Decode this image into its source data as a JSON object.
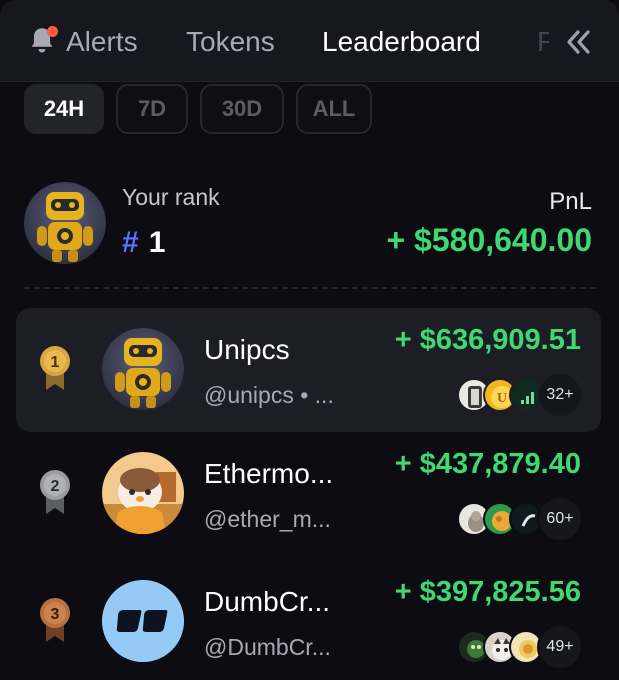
{
  "nav": {
    "tabs": [
      {
        "label": "Alerts",
        "icon": "bell-icon",
        "active": false,
        "has_notification": true
      },
      {
        "label": "Tokens",
        "active": false
      },
      {
        "label": "Leaderboard",
        "active": true
      },
      {
        "label": "F",
        "active": false
      }
    ],
    "collapse_icon": "double-chevron-left-icon"
  },
  "filters": [
    {
      "label": "24H",
      "active": true
    },
    {
      "label": "7D",
      "active": false
    },
    {
      "label": "30D",
      "active": false
    },
    {
      "label": "ALL",
      "active": false
    }
  ],
  "your_rank": {
    "label": "Your rank",
    "hash": "#",
    "rank": "1",
    "pnl_label": "PnL",
    "pnl": "+ $580,640.00"
  },
  "leaderboard": [
    {
      "rank": "1",
      "medal": "gold",
      "name": "Unipcs",
      "handle": "@unipcs • ...",
      "pnl": "+ $636,909.51",
      "tokens_more": "32+"
    },
    {
      "rank": "2",
      "medal": "silver",
      "name": "Ethermo...",
      "handle": "@ether_m...",
      "pnl": "+ $437,879.40",
      "tokens_more": "60+"
    },
    {
      "rank": "3",
      "medal": "bronze",
      "name": "DumbCr...",
      "handle": "@DumbCr...",
      "pnl": "+ $397,825.56",
      "tokens_more": "49+"
    }
  ],
  "colors": {
    "accent_green": "#3fd871",
    "rank_hash_blue": "#5b73ff",
    "notification_dot": "#ff5a3c",
    "gold": "#d9a441",
    "silver": "#9a9aa3",
    "bronze": "#b8703e"
  }
}
